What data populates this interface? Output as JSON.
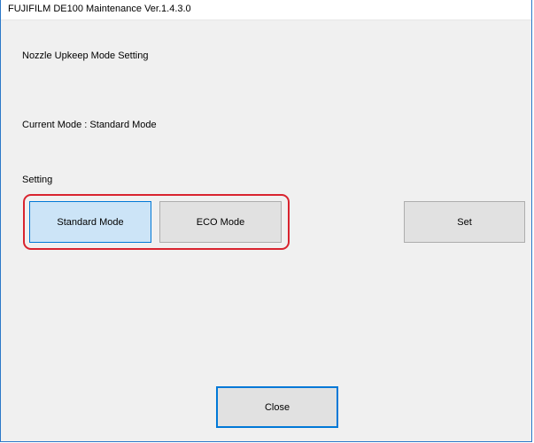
{
  "window": {
    "title": "FUJIFILM DE100 Maintenance Ver.1.4.3.0"
  },
  "main": {
    "heading": "Nozzle Upkeep Mode Setting",
    "current_mode": "Current Mode : Standard Mode",
    "setting_label": "Setting"
  },
  "mode_buttons": {
    "standard_label": "Standard Mode",
    "eco_label": "ECO Mode",
    "selected": "Standard Mode"
  },
  "actions": {
    "set_label": "Set",
    "close_label": "Close"
  },
  "colors": {
    "selected_button_bg": "#cce4f7",
    "focus_border": "#0078d7",
    "annotation_highlight": "#d9242f",
    "window_bg": "#f0f0f0"
  }
}
